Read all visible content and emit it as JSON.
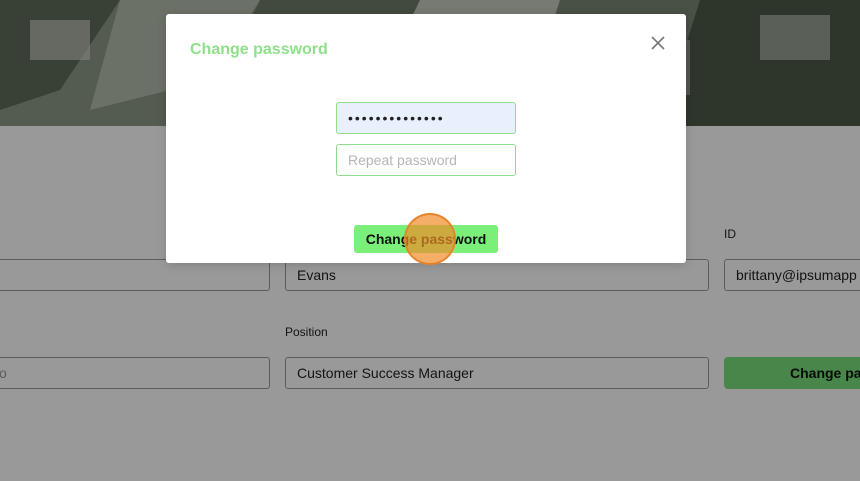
{
  "page": {
    "field_last_name": "Evans",
    "field_position_label": "Position",
    "field_position": "Customer Success Manager",
    "field_id_label": "ID",
    "field_id": "brittany@ipsumapp",
    "field_left_partial": "o",
    "change_password_button": "Change pa"
  },
  "modal": {
    "title": "Change password",
    "password_value": "••••••••••••••",
    "repeat_placeholder": "Repeat password",
    "submit_label": "Change password"
  },
  "colors": {
    "accent": "#7af07a",
    "title": "#8fe08a",
    "input_border": "#8fdc8a",
    "autofill_bg": "#e8f0fe",
    "click_marker": "#f08c28"
  }
}
